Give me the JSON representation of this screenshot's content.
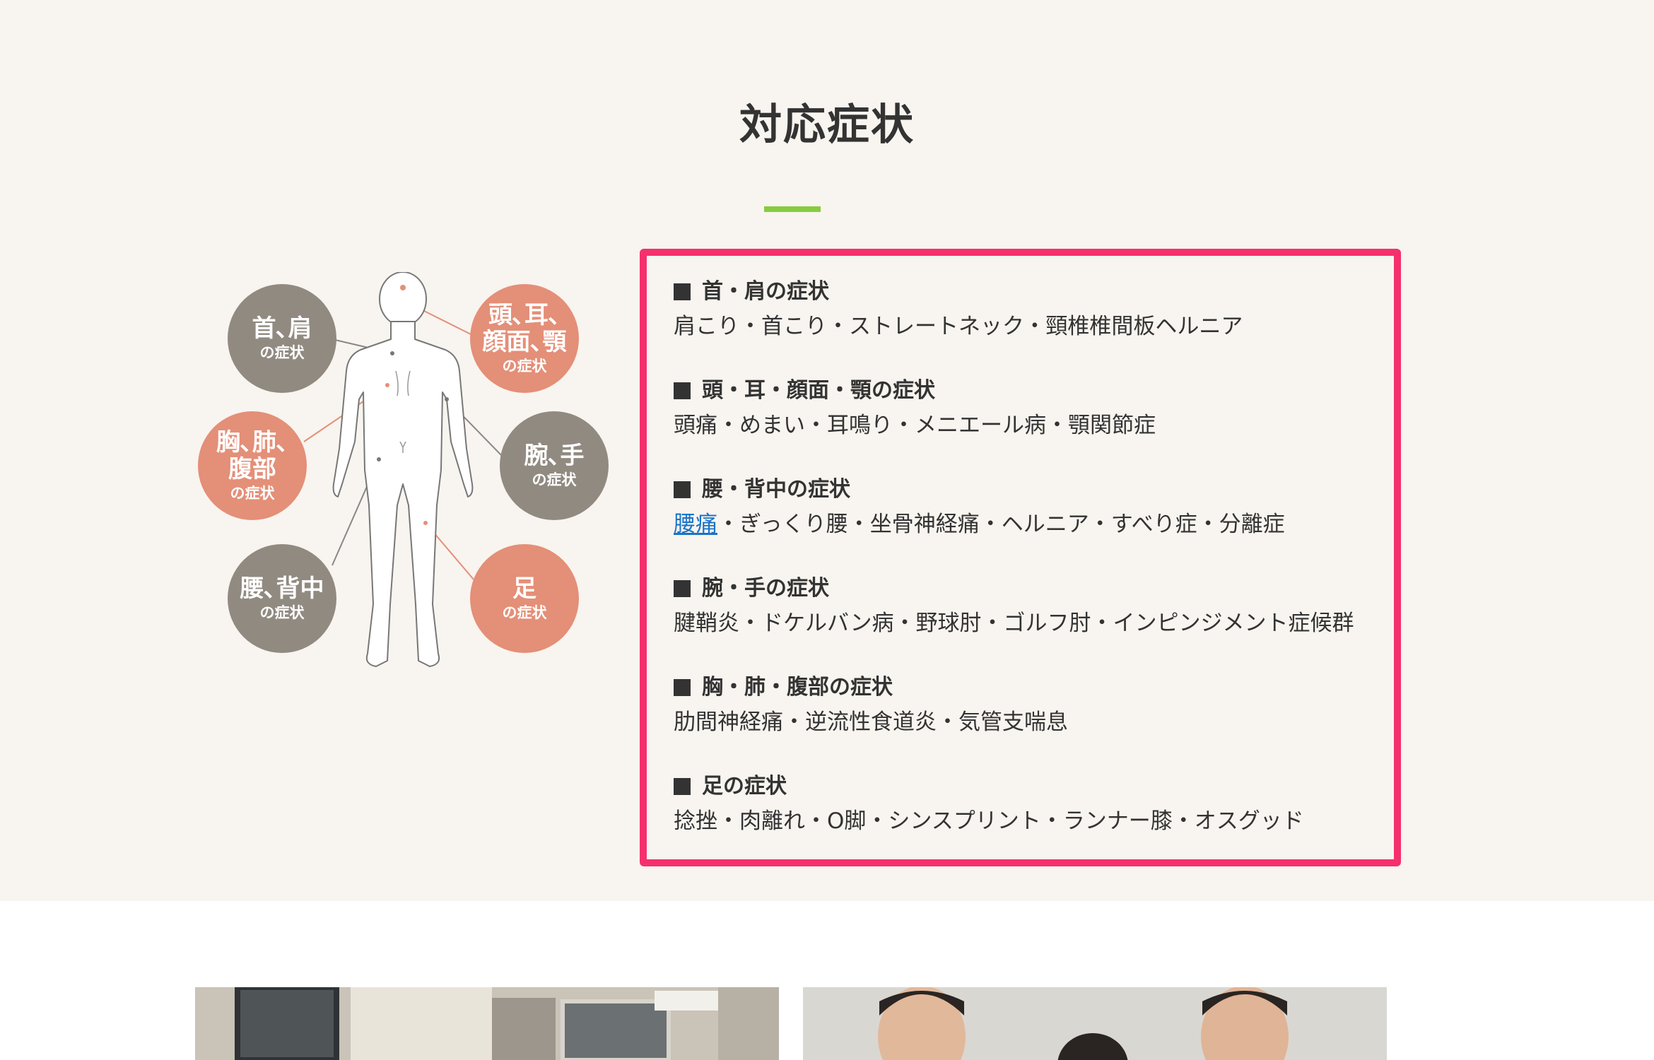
{
  "section": {
    "title": "対応症状"
  },
  "diagram": {
    "labels": [
      {
        "id": "neck",
        "main": "首､肩",
        "sub": "の症状",
        "color": "#918a81"
      },
      {
        "id": "head",
        "main": "頭､耳､顔面､顎",
        "main_lines": [
          "頭､耳､",
          "顔面､顎"
        ],
        "sub": "の症状",
        "color": "#e48f78"
      },
      {
        "id": "chest",
        "main_lines": [
          "胸､肺､",
          "腹部"
        ],
        "sub": "の症状",
        "color": "#e48f78"
      },
      {
        "id": "arm",
        "main": "腕､手",
        "sub": "の症状",
        "color": "#918a81"
      },
      {
        "id": "back",
        "main": "腰､背中",
        "sub": "の症状",
        "color": "#918a81"
      },
      {
        "id": "foot",
        "main": "足",
        "sub": "の症状",
        "color": "#e48f78"
      }
    ]
  },
  "symptoms": {
    "groups": [
      {
        "heading": "首・肩の症状",
        "items": "肩こり・首こり・ストレートネック・頸椎椎間板ヘルニア"
      },
      {
        "heading": "頭・耳・顔面・顎の症状",
        "items": "頭痛・めまい・耳鳴り・メニエール病・顎関節症"
      },
      {
        "heading": "腰・背中の症状",
        "link": "腰痛",
        "items": "・ぎっくり腰・坐骨神経痛・ヘルニア・すべり症・分離症"
      },
      {
        "heading": "腕・手の症状",
        "items": "腱鞘炎・ドケルバン病・野球肘・ゴルフ肘・インピンジメント症候群"
      },
      {
        "heading": "胸・肺・腹部の症状",
        "items": "肋間神経痛・逆流性食道炎・気管支喘息"
      },
      {
        "heading": "足の症状",
        "items": "捻挫・肉離れ・O脚・シンスプリント・ランナー膝・オスグッド"
      }
    ]
  },
  "colors": {
    "accent_border": "#f5306d",
    "underline": "#86cc3e",
    "gray_circle": "#918a81",
    "salmon_circle": "#e48f78",
    "link": "#1a73c8"
  }
}
